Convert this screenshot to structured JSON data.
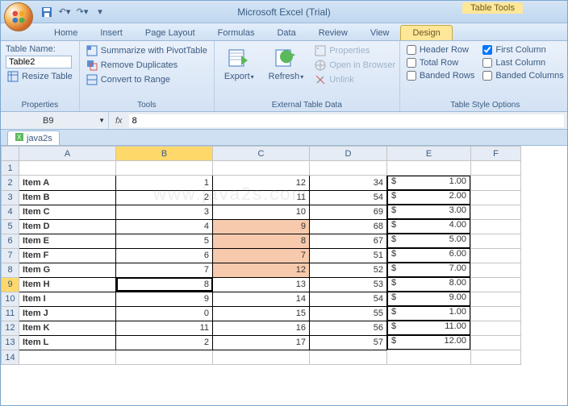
{
  "title": "Microsoft Excel (Trial)",
  "contextual_tab_group": "Table Tools",
  "tabs": [
    "Home",
    "Insert",
    "Page Layout",
    "Formulas",
    "Data",
    "Review",
    "View",
    "Design"
  ],
  "active_tab_index": 7,
  "ribbon": {
    "properties": {
      "label": "Properties",
      "table_name_label": "Table Name:",
      "table_name_value": "Table2",
      "resize": "Resize Table"
    },
    "tools": {
      "label": "Tools",
      "summarize": "Summarize with PivotTable",
      "dedup": "Remove Duplicates",
      "convert": "Convert to Range"
    },
    "ext": {
      "label": "External Table Data",
      "export": "Export",
      "refresh": "Refresh",
      "props": "Properties",
      "browser": "Open in Browser",
      "unlink": "Unlink"
    },
    "styleopts": {
      "label": "Table Style Options",
      "header_row": "Header Row",
      "total_row": "Total Row",
      "banded_rows": "Banded Rows",
      "first_col": "First Column",
      "last_col": "Last Column",
      "banded_cols": "Banded Columns"
    }
  },
  "namebox": "B9",
  "formula": "8",
  "workbook_tab": "java2s",
  "columns": [
    "A",
    "B",
    "C",
    "D",
    "E",
    "F"
  ],
  "rows": [
    {
      "n": 1,
      "a": "",
      "b": "",
      "c": "",
      "d": "",
      "e": "",
      "or": false
    },
    {
      "n": 2,
      "a": "Item A",
      "b": "1",
      "c": "12",
      "d": "34",
      "e": "1.00",
      "or": false
    },
    {
      "n": 3,
      "a": "Item B",
      "b": "2",
      "c": "11",
      "d": "54",
      "e": "2.00",
      "or": false
    },
    {
      "n": 4,
      "a": "Item C",
      "b": "3",
      "c": "10",
      "d": "69",
      "e": "3.00",
      "or": false
    },
    {
      "n": 5,
      "a": "Item D",
      "b": "4",
      "c": "9",
      "d": "68",
      "e": "4.00",
      "or": true
    },
    {
      "n": 6,
      "a": "Item E",
      "b": "5",
      "c": "8",
      "d": "67",
      "e": "5.00",
      "or": true
    },
    {
      "n": 7,
      "a": "Item F",
      "b": "6",
      "c": "7",
      "d": "51",
      "e": "6.00",
      "or": true
    },
    {
      "n": 8,
      "a": "Item G",
      "b": "7",
      "c": "12",
      "d": "52",
      "e": "7.00",
      "or": true
    },
    {
      "n": 9,
      "a": "Item H",
      "b": "8",
      "c": "13",
      "d": "53",
      "e": "8.00",
      "or": false
    },
    {
      "n": 10,
      "a": "Item I",
      "b": "9",
      "c": "14",
      "d": "54",
      "e": "9.00",
      "or": false
    },
    {
      "n": 11,
      "a": "Item J",
      "b": "0",
      "c": "15",
      "d": "55",
      "e": "1.00",
      "or": false
    },
    {
      "n": 12,
      "a": "Item K",
      "b": "11",
      "c": "16",
      "d": "56",
      "e": "11.00",
      "or": false
    },
    {
      "n": 13,
      "a": "Item L",
      "b": "2",
      "c": "17",
      "d": "57",
      "e": "12.00",
      "or": false
    },
    {
      "n": 14,
      "a": "",
      "b": "",
      "c": "",
      "d": "",
      "e": "",
      "or": false
    }
  ],
  "active_cell": {
    "row": 9,
    "col": "B"
  },
  "checks": {
    "header_row": false,
    "total_row": false,
    "banded_rows": false,
    "first_col": true,
    "last_col": false,
    "banded_cols": false
  },
  "watermark": "www.java2s.com"
}
